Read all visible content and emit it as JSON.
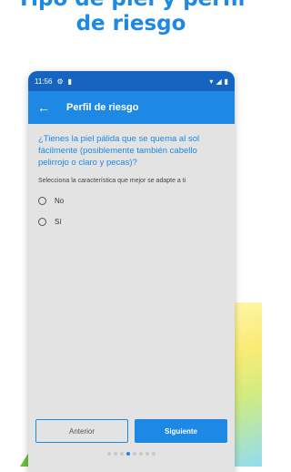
{
  "headline": {
    "line1": "Tipo de piel y perfil",
    "line2": "de riesgo"
  },
  "statusbar": {
    "time": "11:56"
  },
  "appbar": {
    "title": "Perfil de riesgo"
  },
  "survey": {
    "question": "¿Tienes la piel pálida que se quema al sol fácilmente (posiblemente también cabello pelirrojo o claro y pecas)?",
    "instruction": "Selecciona la característica que mejor se adapte a ti",
    "options": [
      {
        "label": "No",
        "selected": false
      },
      {
        "label": "Sí",
        "selected": false
      }
    ]
  },
  "buttons": {
    "previous": "Anterior",
    "next": "Siguiente"
  },
  "pagination": {
    "total": 8,
    "current": 3
  },
  "colors": {
    "primary": "#1e88e5",
    "primary_dark": "#1565c0",
    "background": "#e3e3e3"
  }
}
